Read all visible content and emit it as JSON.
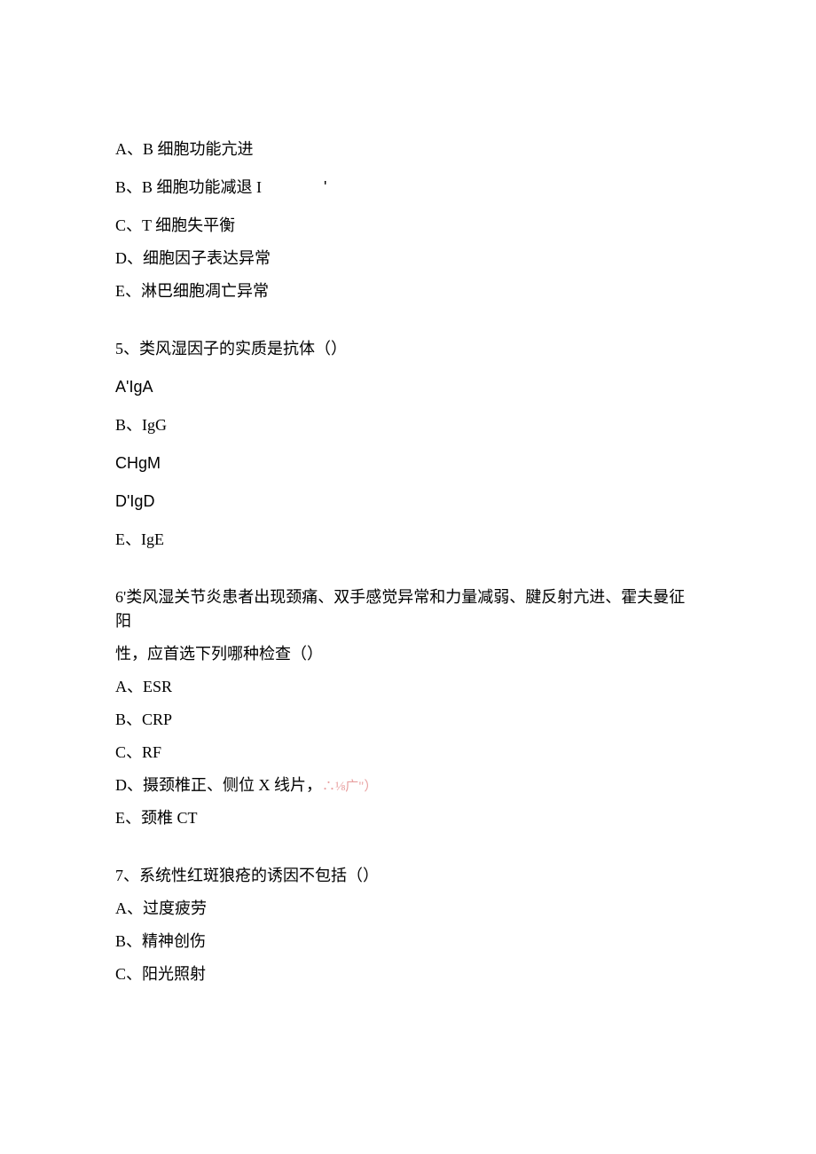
{
  "q4_options": {
    "a": "A、B 细胞功能亢进",
    "b_prefix": "B、B 细胞功能减退 I",
    "b_tick": "'",
    "c": "C、T 细胞失平衡",
    "d": "D、细胞因子表达异常",
    "e": "E、淋巴细胞凋亡异常"
  },
  "q5": {
    "stem": "5、类风湿因子的实质是抗体（）",
    "a": "A'IgA",
    "b": "B、IgG",
    "c": "CHgM",
    "d": "D'IgD",
    "e": "E、IgE"
  },
  "q6": {
    "stem_line1": "6'类风湿关节炎患者出现颈痛、双手感觉异常和力量减弱、腱反射亢进、霍夫曼征阳",
    "stem_line2": "性，应首选下列哪种检查（）",
    "a": "A、ESR",
    "b": "B、CRP",
    "c": "C、RF",
    "d_prefix": "D、摄颈椎正、侧位 X 线片，",
    "d_faded": "∴⅛广\"）",
    "e": "E、颈椎 CT"
  },
  "q7": {
    "stem": "7、系统性红斑狼疮的诱因不包括（）",
    "a": "A、过度疲劳",
    "b": "B、精神创伤",
    "c": "C、阳光照射"
  }
}
